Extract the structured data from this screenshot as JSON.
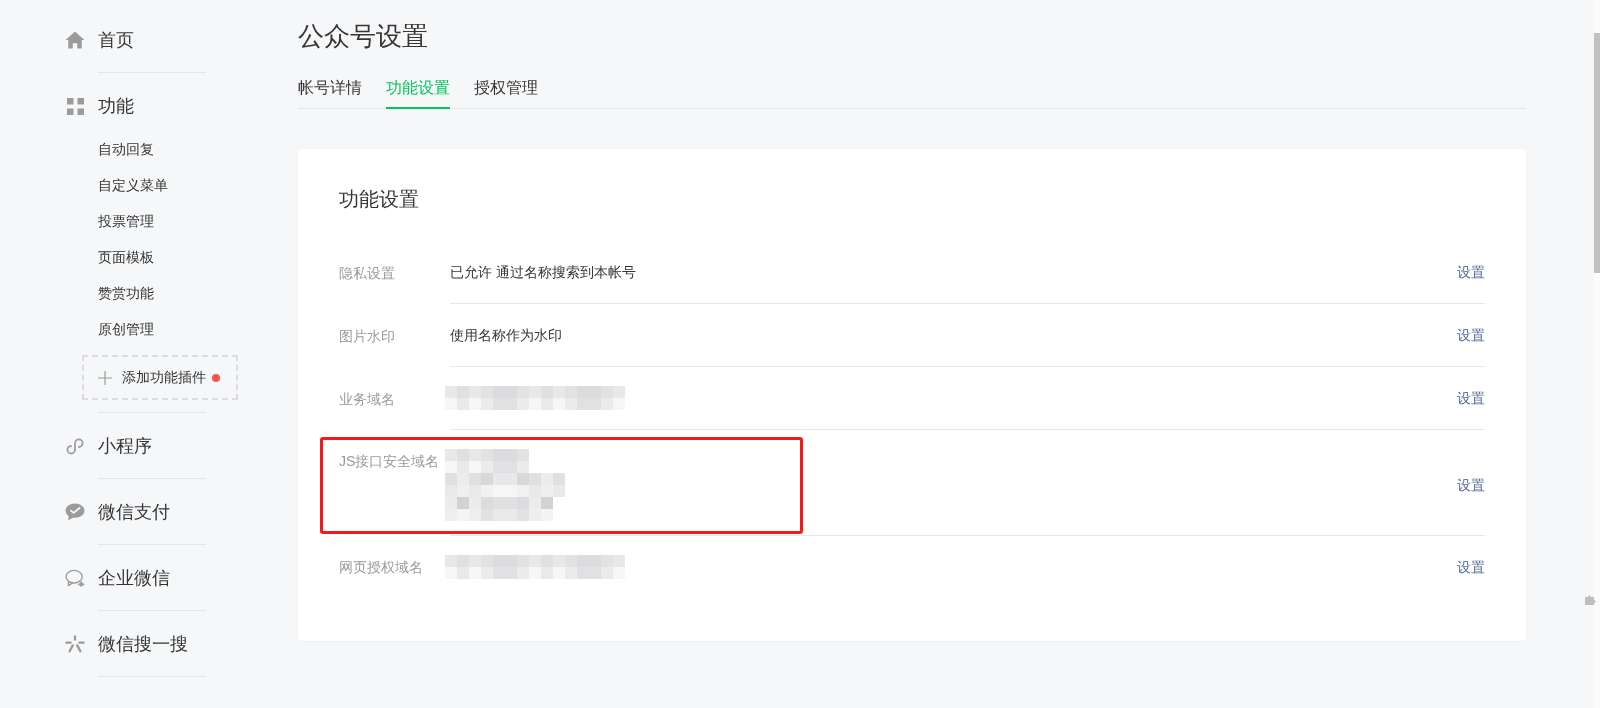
{
  "sidebar": {
    "sections": [
      {
        "label": "首页",
        "selected": false
      },
      {
        "label": "功能",
        "selected": false,
        "children": [
          {
            "label": "自动回复",
            "selected": false
          },
          {
            "label": "自定义菜单",
            "selected": false
          },
          {
            "label": "投票管理",
            "selected": false
          },
          {
            "label": "页面模板",
            "selected": false
          },
          {
            "label": "赞赏功能",
            "selected": false
          },
          {
            "label": "原创管理",
            "selected": false
          }
        ],
        "add_plugin": {
          "label": "添加功能插件",
          "notification": true
        }
      },
      {
        "label": "小程序",
        "selected": false
      },
      {
        "label": "微信支付",
        "selected": false
      },
      {
        "label": "企业微信",
        "selected": false
      },
      {
        "label": "微信搜一搜",
        "selected": false
      }
    ]
  },
  "page": {
    "title": "公众号设置",
    "tabs": [
      {
        "label": "帐号详情",
        "selected": false
      },
      {
        "label": "功能设置",
        "selected": true
      },
      {
        "label": "授权管理",
        "selected": false
      }
    ]
  },
  "card": {
    "title": "功能设置",
    "rows": [
      {
        "label": "隐私设置",
        "kind": "text",
        "value": "已允许 通过名称搜索到本帐号",
        "action": "设置",
        "highlighted": false
      },
      {
        "label": "图片水印",
        "kind": "text",
        "value": "使用名称作为水印",
        "action": "设置",
        "highlighted": false
      },
      {
        "label": "业务域名",
        "kind": "mosaic",
        "action": "设置",
        "highlighted": false
      },
      {
        "label": "JS接口安全域名",
        "kind": "mosaicblock",
        "action": "设置",
        "highlighted": true
      },
      {
        "label": "网页授权域名",
        "kind": "mosaic",
        "action": "设置",
        "highlighted": false
      }
    ]
  }
}
